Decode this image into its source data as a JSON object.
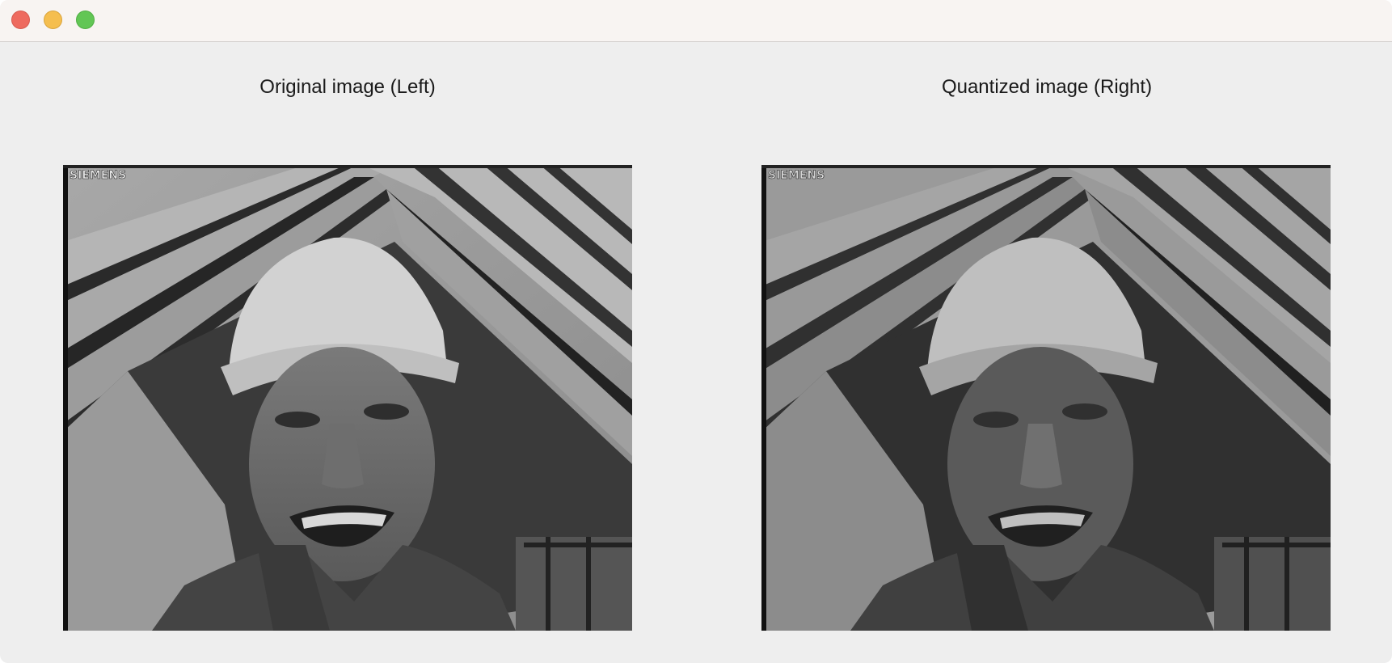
{
  "window": {
    "controls": {
      "close": "close-button",
      "minimize": "minimize-button",
      "maximize": "maximize-button"
    }
  },
  "panels": {
    "left": {
      "title": "Original image (Left)",
      "watermark": "SIEMENS"
    },
    "right": {
      "title": "Quantized image (Right)",
      "watermark": "SIEMENS"
    }
  },
  "colors": {
    "close": "#ee6a5f",
    "minimize": "#f5be4f",
    "maximize": "#62c655",
    "window_bg": "#eeeeee",
    "titlebar_bg": "#f8f4f2"
  }
}
